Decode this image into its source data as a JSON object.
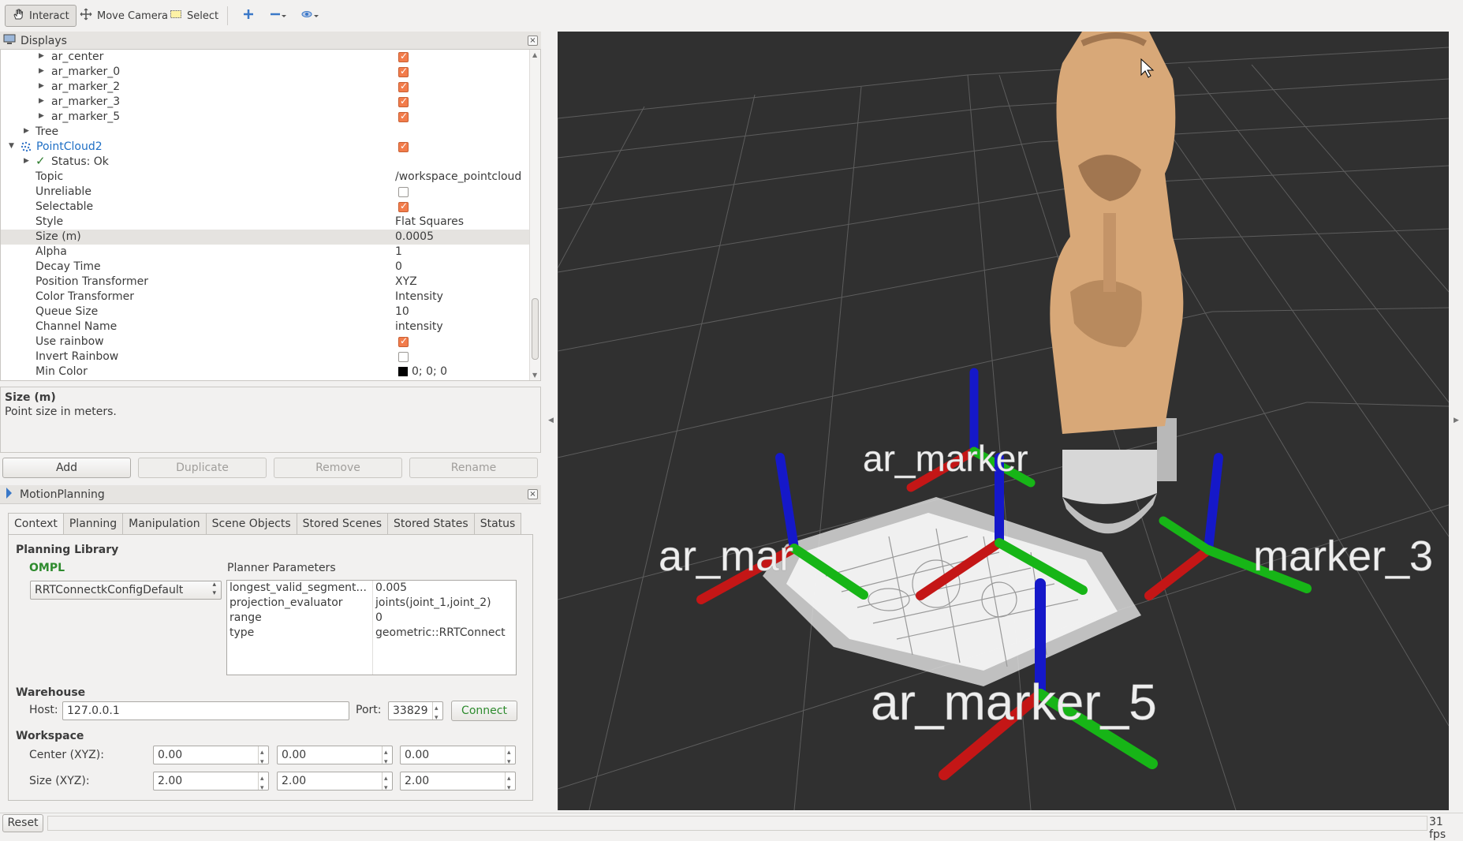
{
  "toolbar": {
    "interact": "Interact",
    "move_camera": "Move Camera",
    "select": "Select"
  },
  "displays": {
    "title": "Displays",
    "rows": [
      {
        "label": "ar_center",
        "checked": true
      },
      {
        "label": "ar_marker_0",
        "checked": true
      },
      {
        "label": "ar_marker_2",
        "checked": true
      },
      {
        "label": "ar_marker_3",
        "checked": true
      },
      {
        "label": "ar_marker_5",
        "checked": true
      },
      {
        "label": "Tree"
      },
      {
        "label": "PointCloud2",
        "checked": true
      },
      {
        "label": "Status: Ok"
      },
      {
        "label": "Topic",
        "value": "/workspace_pointcloud"
      },
      {
        "label": "Unreliable",
        "checked": false
      },
      {
        "label": "Selectable",
        "checked": true
      },
      {
        "label": "Style",
        "value": "Flat Squares"
      },
      {
        "label": "Size (m)",
        "value": "0.0005"
      },
      {
        "label": "Alpha",
        "value": "1"
      },
      {
        "label": "Decay Time",
        "value": "0"
      },
      {
        "label": "Position Transformer",
        "value": "XYZ"
      },
      {
        "label": "Color Transformer",
        "value": "Intensity"
      },
      {
        "label": "Queue Size",
        "value": "10"
      },
      {
        "label": "Channel Name",
        "value": "intensity"
      },
      {
        "label": "Use rainbow",
        "checked": true
      },
      {
        "label": "Invert Rainbow",
        "checked": false
      },
      {
        "label": "Min Color",
        "value": "0; 0; 0"
      }
    ],
    "help_title": "Size (m)",
    "help_text": "Point size in meters.",
    "buttons": {
      "add": "Add",
      "duplicate": "Duplicate",
      "remove": "Remove",
      "rename": "Rename"
    }
  },
  "motion_planning": {
    "title": "MotionPlanning",
    "tabs": [
      "Context",
      "Planning",
      "Manipulation",
      "Scene Objects",
      "Stored Scenes",
      "Stored States",
      "Status"
    ],
    "planning_library_label": "Planning Library",
    "library_name": "OMPL",
    "planner": "RRTConnectkConfigDefault",
    "planner_params_label": "Planner Parameters",
    "params": [
      {
        "key": "longest_valid_segment...",
        "value": "0.005"
      },
      {
        "key": "projection_evaluator",
        "value": "joints(joint_1,joint_2)"
      },
      {
        "key": "range",
        "value": "0"
      },
      {
        "key": "type",
        "value": "geometric::RRTConnect"
      }
    ],
    "warehouse_label": "Warehouse",
    "host_label": "Host:",
    "host": "127.0.0.1",
    "port_label": "Port:",
    "port": "33829",
    "connect": "Connect",
    "workspace_label": "Workspace",
    "center_label": "Center (XYZ):",
    "center": [
      "0.00",
      "0.00",
      "0.00"
    ],
    "size_label": "Size (XYZ):",
    "size": [
      "2.00",
      "2.00",
      "2.00"
    ]
  },
  "viewport": {
    "labels": [
      "ar_marker",
      "ar_mar",
      "marker_3",
      "ar_marker_5"
    ]
  },
  "status": {
    "reset": "Reset",
    "fps": "31 fps"
  }
}
